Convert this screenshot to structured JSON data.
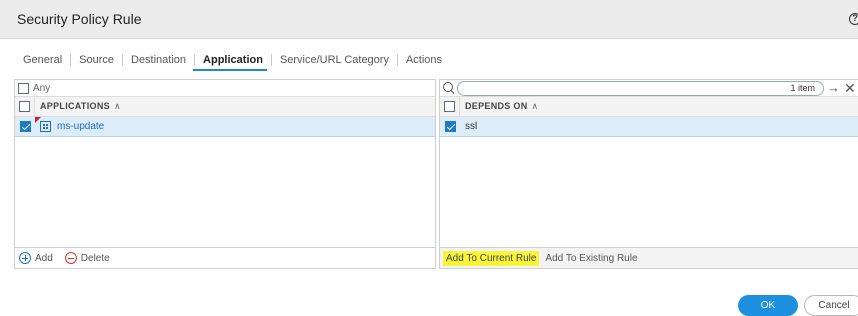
{
  "dialog": {
    "title": "Security Policy Rule",
    "help_glyph": "?"
  },
  "tabs": [
    {
      "label": "General"
    },
    {
      "label": "Source"
    },
    {
      "label": "Destination"
    },
    {
      "label": "Application",
      "active": true
    },
    {
      "label": "Service/URL Category"
    },
    {
      "label": "Actions"
    }
  ],
  "applications": {
    "any_label": "Any",
    "column_header": "APPLICATIONS",
    "rows": [
      {
        "name": "ms-update",
        "checked": true
      }
    ],
    "footer": {
      "add_label": "Add",
      "delete_label": "Delete"
    }
  },
  "depends": {
    "search": {
      "value": "1 item"
    },
    "column_header": "DEPENDS ON",
    "rows": [
      {
        "name": "ssl",
        "checked": true
      }
    ],
    "footer": {
      "add_current_label": "Add To Current Rule",
      "add_existing_label": "Add To Existing Rule"
    }
  },
  "buttons": {
    "ok_label": "OK",
    "cancel_label": "Cancel"
  },
  "colors": {
    "accent": "#1e90e0",
    "selected_row": "#dcecf8",
    "highlight": "#f9f53a"
  }
}
